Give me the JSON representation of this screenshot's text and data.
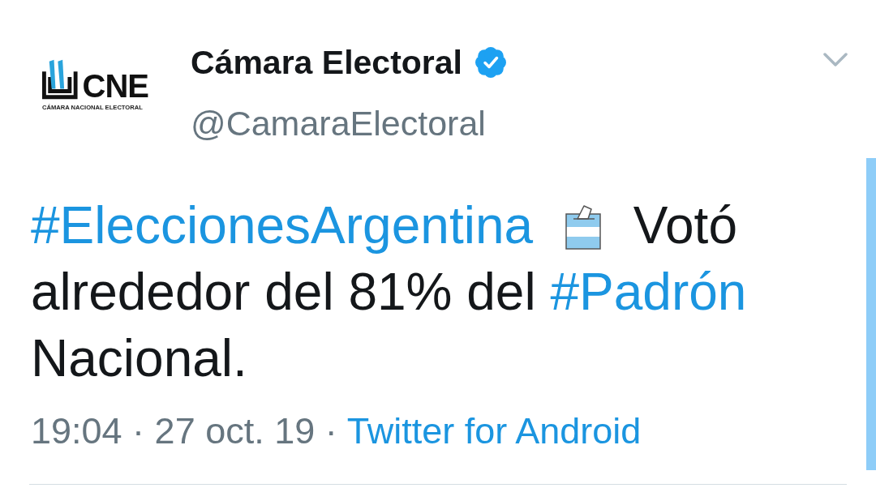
{
  "tweet": {
    "author": {
      "logo": {
        "acronym": "CNE",
        "caption": "CÁMARA NACIONAL ELECTORAL"
      },
      "name": "Cámara Electoral",
      "verified": true,
      "handle": "@CamaraElectoral"
    },
    "body": [
      {
        "kind": "hashtag",
        "text": "#EleccionesArgentina"
      },
      {
        "kind": "emoji"
      },
      {
        "kind": "text",
        "text": "Votó alrededor del 81% del"
      },
      {
        "kind": "hashtag",
        "text": "#Padrón"
      },
      {
        "kind": "text",
        "text": "Nacional."
      }
    ],
    "meta": {
      "timestamp": "19:04 · 27 oct. 19 ·",
      "source": "Twitter for Android"
    }
  }
}
